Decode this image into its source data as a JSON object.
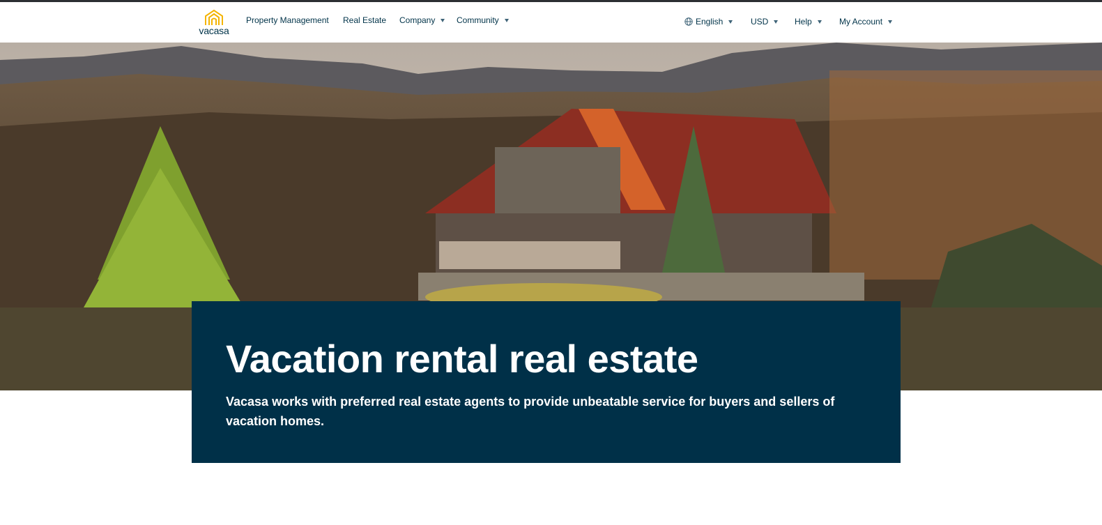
{
  "brand": {
    "name": "vacasa",
    "logo_color": "#f4b400",
    "primary_color": "#003349"
  },
  "nav": {
    "left": [
      {
        "label": "Property Management",
        "dropdown": false
      },
      {
        "label": "Real Estate",
        "dropdown": false
      },
      {
        "label": "Company",
        "dropdown": true
      },
      {
        "label": "Community",
        "dropdown": true
      }
    ],
    "right": {
      "language": "English",
      "language_icon": "globe-icon",
      "currency": "USD",
      "help": "Help",
      "account": "My Account"
    }
  },
  "hero": {
    "image_alt": "Mountain cabin at sunset",
    "title": "Vacation rental real estate",
    "description": "Vacasa works with preferred real estate agents to provide unbeatable service for buyers and sellers of vacation homes.",
    "card_color": "#003048"
  }
}
